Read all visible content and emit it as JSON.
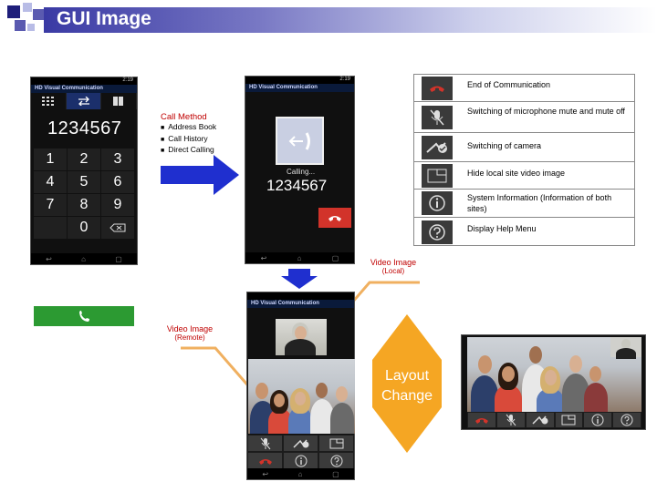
{
  "title": "GUI Image",
  "dialer": {
    "app_title": "Visual Communication",
    "number": "1234567",
    "keys": [
      "1",
      "2",
      "3",
      "4",
      "5",
      "6",
      "7",
      "8",
      "9",
      "0"
    ],
    "time": "2:19"
  },
  "calling": {
    "app_title": "Visual Communication",
    "status": "Calling...",
    "number": "1234567",
    "time": "2:19"
  },
  "call_method": {
    "title": "Call Method",
    "items": [
      "Address Book",
      "Call History",
      "Direct Calling"
    ]
  },
  "functions": [
    {
      "icon": "end-call-icon",
      "text": "End of Communication"
    },
    {
      "icon": "mic-mute-icon",
      "text": "Switching of microphone mute and mute off"
    },
    {
      "icon": "camera-switch-icon",
      "text": "Switching of camera"
    },
    {
      "icon": "hide-local-video-icon",
      "text": "Hide local site video image"
    },
    {
      "icon": "info-icon",
      "text": "System Information (Information of both sites)"
    },
    {
      "icon": "help-icon",
      "text": "Display Help Menu"
    }
  ],
  "captions": {
    "video_local_title": "Video Image",
    "video_local_sub": "(Local)",
    "video_remote_title": "Video Image",
    "video_remote_sub": "(Remote)",
    "layout_change": "Layout Change"
  },
  "colors": {
    "caption_red": "#c00000",
    "arrow_blue": "#1f2fcf",
    "layout_orange": "#f5a623",
    "callout_orange": "#f0b060",
    "end_call_red": "#d2332a",
    "call_green": "#2c9a32"
  }
}
